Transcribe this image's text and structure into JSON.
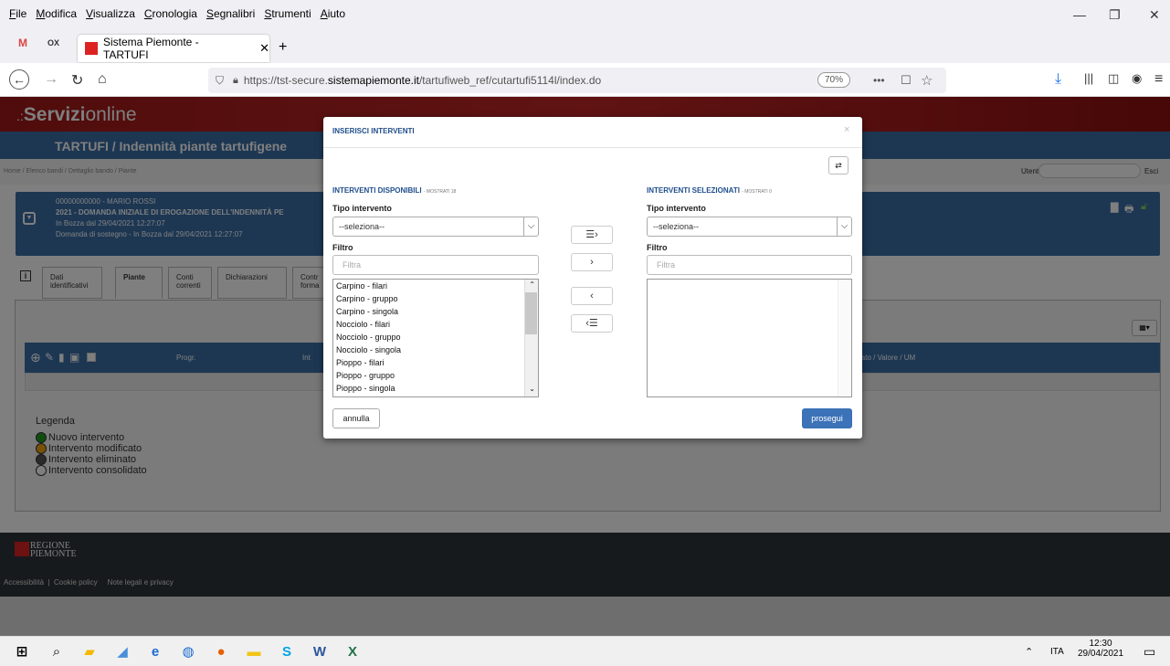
{
  "browser": {
    "menu": [
      "File",
      "Modifica",
      "Visualizza",
      "Cronologia",
      "Segnalibri",
      "Strumenti",
      "Aiuto"
    ],
    "tab_title": "Sistema Piemonte - TARTUFI",
    "url_prefix": "https://tst-secure.",
    "url_domain": "sistemapiemonte.it",
    "url_path": "/tartufiweb_ref/cutartufi5114l/index.do",
    "zoom": "70%"
  },
  "site": {
    "logo_bold": "Servizi",
    "logo_light": "online",
    "app_title": "TARTUFI / Indennità piante tartufigene",
    "breadcrumb": "Home / Elenco bandi / Dettaglio bando / Piante",
    "user_label": "Utente",
    "logout_label": "Esci"
  },
  "info": {
    "line1": "00000000000 - MARIO ROSSI",
    "line2": "2021 - DOMANDA INIZIALE DI EROGAZIONE DELL'INDENNITÀ PE",
    "line3": "In Bozza dal 29/04/2021 12:27:07",
    "line4": "Domanda di sostegno - In Bozza dal 29/04/2021 12:27:07"
  },
  "page_tabs": [
    {
      "l1": "Dati",
      "l2": "identificativi"
    },
    {
      "l1": "Piante",
      "l2": ""
    },
    {
      "l1": "Conti",
      "l2": "correnti"
    },
    {
      "l1": "Dichiarazioni",
      "l2": ""
    },
    {
      "l1": "Contr",
      "l2": "forma"
    }
  ],
  "table": {
    "col_progr": "Progr.",
    "col_int": "Int",
    "col_value": "iato / Valore / UM"
  },
  "legend": {
    "title": "Legenda",
    "items": [
      {
        "label": "Nuovo intervento",
        "color": "#1f9a1f"
      },
      {
        "label": "Intervento modificato",
        "color": "#f2a20c"
      },
      {
        "label": "Intervento eliminato",
        "color": "#555555"
      },
      {
        "label": "Intervento consolidato",
        "color": "#ffffff"
      }
    ]
  },
  "footer": {
    "region_l1": "REGIONE",
    "region_l2": "PIEMONTE",
    "links": "Accessibilità  |  Cookie policy     Note legali e privacy"
  },
  "modal": {
    "title": "INSERISCI INTERVENTI",
    "close": "×",
    "left_header": "INTERVENTI DISPONIBILI",
    "left_count": "- MOSTRATI 18",
    "right_header": "INTERVENTI SELEZIONATI",
    "right_count": "- MOSTRATI 0",
    "tipo_label": "Tipo intervento",
    "select_value": "--seleziona--",
    "filtro_label": "Filtro",
    "filtro_placeholder": "Filtra",
    "available": [
      "Carpino - filari",
      "Carpino - gruppo",
      "Carpino - singola",
      "Nocciolo - filari",
      "Nocciolo - gruppo",
      "Nocciolo - singola",
      "Pioppo - filari",
      "Pioppo - gruppo",
      "Pioppo - singola"
    ],
    "cancel": "annulla",
    "proceed": "prosegui"
  },
  "taskbar": {
    "lang": "ITA",
    "time": "12:30",
    "date": "29/04/2021"
  }
}
